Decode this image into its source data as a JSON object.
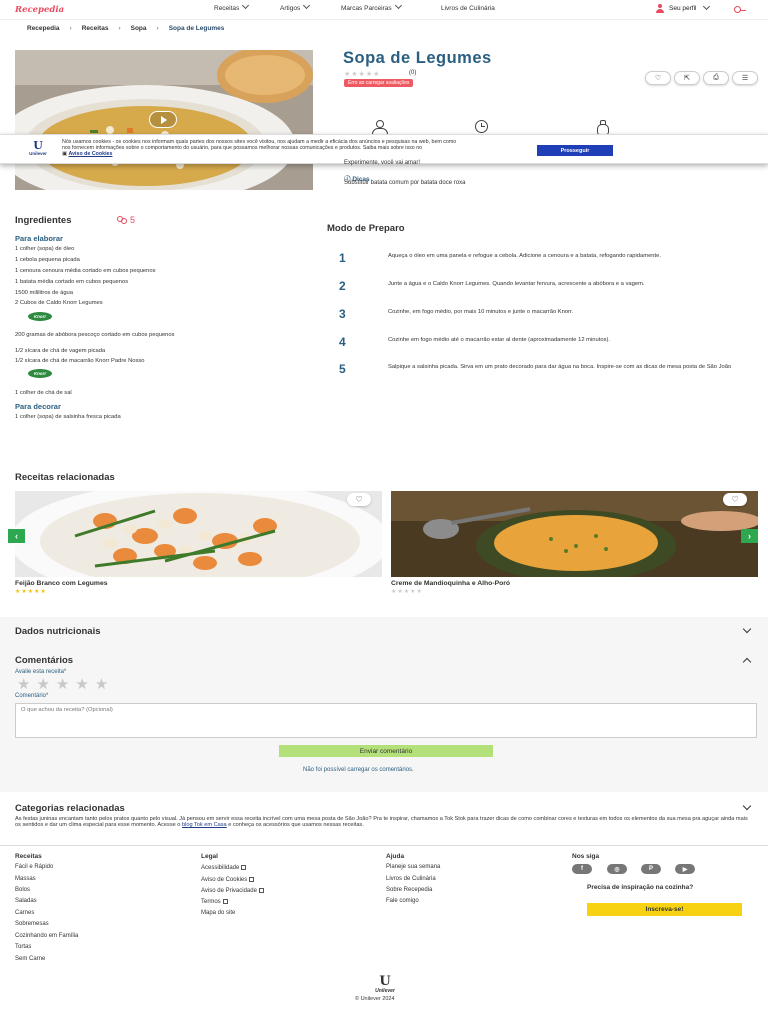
{
  "brand": {
    "logo": "Recepedia"
  },
  "nav": {
    "items": [
      "Receitas",
      "Artigos",
      "Marcas Parceiras",
      "Livros de Culinária"
    ],
    "profile": "Seu perfil"
  },
  "breadcrumb": [
    "Recepedia",
    "Receitas",
    "Sopa",
    "Sopa de Legumes"
  ],
  "recipe": {
    "title": "Sopa de Legumes",
    "rating_count": "(0)",
    "rating_error": "Erro ao carregar avaliações",
    "tagline": "Experimente, você vai amar!",
    "dicas_label": "Dicas",
    "dicas_text": "Substituir batata comum por batata doce roxa"
  },
  "cookie": {
    "text": "Nós usamos cookies - os cookies nos informam quais partes dos nossos sites você visitou, nos ajudam a medir a eficácia dos anúncios e pesquisas na web, bem como nos fornecem informações sobre o comportamento do usuário, para que possamos melhorar nossas comunicações e produtos. Saiba mais sobre isso no",
    "link": "Aviso de Cookies",
    "button": "Prosseguir",
    "logo_name": "Unilever"
  },
  "ingredients": {
    "title": "Ingredientes",
    "servings": "5",
    "elaborar_title": "Para elaborar",
    "elaborar": [
      "1 colher (sopa) de óleo",
      "1 cebola pequena picada",
      "1 cenoura cenoura média cortado em cubos pequenos",
      "1 batata média cortado em cubos pequenos",
      "1500 mililitros de água",
      "2 Cubos de Caldo Knorr Legumes",
      "200 gramas de abóbora pescoço cortado em cubos pequenos",
      "1/2 xícara de chá de vagem picada",
      "1/2 xícara de chá de macarrão Knorr Padre Nosso",
      "1 colher de chá de sal"
    ],
    "decorar_title": "Para decorar",
    "decorar": [
      "1 colher (sopa) de salsinha fresca picada"
    ],
    "knorr_label": "Knorr"
  },
  "preparo": {
    "title": "Modo de Preparo",
    "steps": [
      {
        "n": "1",
        "text": "Aqueça o óleo em uma panela e refogue a cebola.  Adicione a cenoura e a batata, refogando rapidamente."
      },
      {
        "n": "2",
        "text": "Junte a água e o Caldo Knorr Legumes. Quando levantar fervura, acrescente a abóbora e a vagem."
      },
      {
        "n": "3",
        "text": "Cozinhe, em fogo médio, por mais 10 minutos e junte o macarrão Knorr."
      },
      {
        "n": "4",
        "text": "Cozinhe em fogo médio até o macarrão estar al dente (aproximadamente 12 minutos)."
      },
      {
        "n": "5",
        "text": "Salpique a salsinha picada. Sirva em um prato decorado para dar água na boca. Inspire-se com as dicas de mesa posta de São João"
      }
    ]
  },
  "related": {
    "title": "Receitas relacionadas",
    "cards": [
      {
        "title": "Feijão Branco com Legumes",
        "stars": "★★★★★",
        "rating": 5,
        "star_color": "#f4c20d"
      },
      {
        "title": "Creme de Mandioquinha e Alho-Poró",
        "stars": "★★★★★",
        "rating": 0,
        "star_color": "#cccccc"
      }
    ]
  },
  "nutrition": {
    "title": "Dados nutricionais"
  },
  "comments": {
    "title": "Comentários",
    "rate_label": "Avalie esta receita",
    "rate_stars": "★★★★★",
    "comment_label": "Comentário",
    "placeholder": "O que achou da receita? (Opcional)",
    "send": "Enviar comentário",
    "error": "Não foi possível carregar os comentários."
  },
  "categories": {
    "title": "Categorias relacionadas",
    "text": "As festas juninas encantam tanto pelos pratos quanto pelo visual. Já pensou em servir essa receita incrível com uma mesa posta de São João? Pra te inspirar, chamamos a Tok Stok para trazer dicas de como combinar cores e texturas em todos os elementos da sua mesa pra aguçar ainda mais os sentidos e dar um clima especial para esse momento. Acesse o",
    "link": "blog Tok em Casa",
    "tail": "e conheça os acessórios que usamos nessas receitas."
  },
  "footer": {
    "col1": {
      "title": "Receitas",
      "items": [
        "Fácil e Rápido",
        "Massas",
        "Bolos",
        "Saladas",
        "Carnes",
        "Sobremesas",
        "Cozinhando em Família",
        "Tortas",
        "Sem Carne"
      ]
    },
    "col2": {
      "title": "Legal",
      "items": [
        "Acessibilidade",
        "Aviso de Cookies",
        "Aviso de Privacidade",
        "Termos",
        "Mapa do site"
      ]
    },
    "col3": {
      "title": "Ajuda",
      "items": [
        "Planeje sua semana",
        "Livros de Culinária",
        "Sobre Recepedia",
        "Fale comigo"
      ]
    },
    "col4": {
      "title": "Nos siga",
      "social": [
        "f",
        "◎",
        "P",
        "▶"
      ]
    },
    "newsletter": {
      "question": "Precisa de inspiração na cozinha?",
      "button": "Inscreva-se!"
    },
    "logo": "Unilever",
    "copyright": "© Unilever 2024"
  },
  "colors": {
    "brand": "#e84a5f",
    "title": "#2b5f82",
    "accent_green": "#2ea84e",
    "cookie_button": "#1f3fb8"
  }
}
